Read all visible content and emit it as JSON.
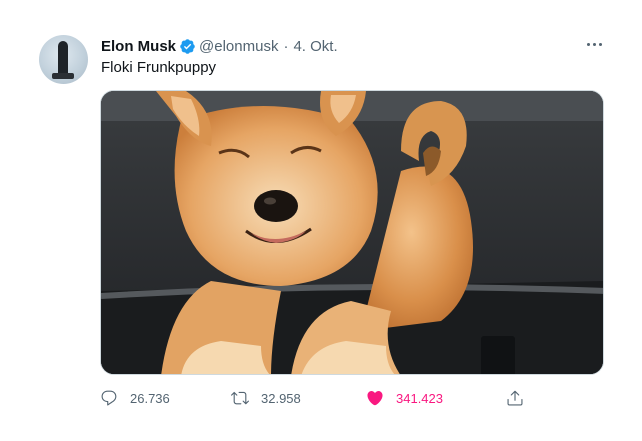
{
  "author": {
    "name": "Elon Musk",
    "handle": "@elonmusk",
    "separator": "·",
    "date": "4. Okt."
  },
  "tweet": {
    "text": "Floki Frunkpuppy"
  },
  "media": {
    "description_icon": "shiba-inu-puppy-photo"
  },
  "actions": {
    "replies": "26.736",
    "retweets": "32.958",
    "likes": "341.423"
  },
  "colors": {
    "verified": "#1d9bf0",
    "like": "#f91880",
    "muted": "#536471"
  }
}
